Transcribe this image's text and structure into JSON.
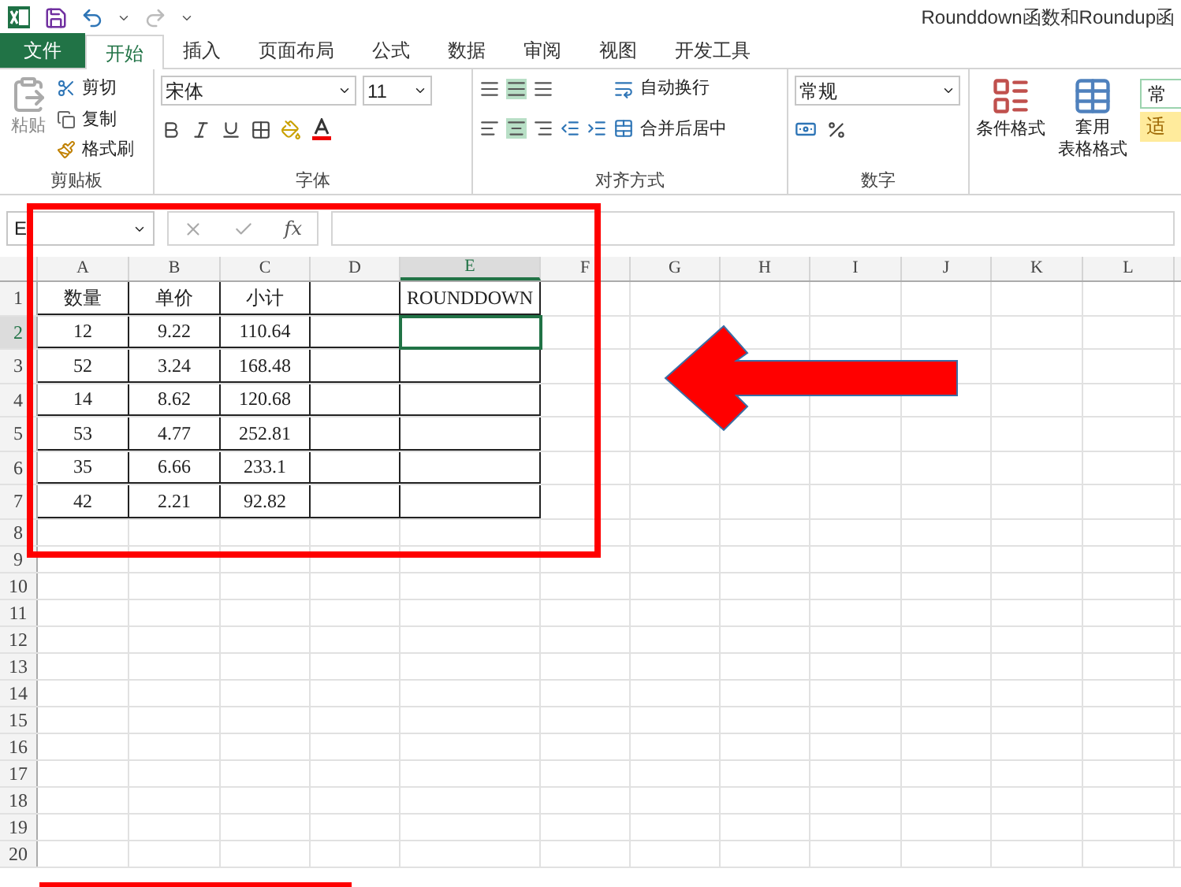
{
  "window": {
    "title": "Rounddown函数和Roundup函"
  },
  "tabs": [
    {
      "label": "文件",
      "kind": "file",
      "selected": false
    },
    {
      "label": "开始",
      "kind": "tab",
      "selected": true
    },
    {
      "label": "插入",
      "kind": "tab",
      "selected": false
    },
    {
      "label": "页面布局",
      "kind": "tab",
      "selected": false
    },
    {
      "label": "公式",
      "kind": "tab",
      "selected": false
    },
    {
      "label": "数据",
      "kind": "tab",
      "selected": false
    },
    {
      "label": "审阅",
      "kind": "tab",
      "selected": false
    },
    {
      "label": "视图",
      "kind": "tab",
      "selected": false
    },
    {
      "label": "开发工具",
      "kind": "tab",
      "selected": false
    }
  ],
  "ribbon": {
    "clipboard": {
      "title": "剪贴板",
      "paste": "粘贴",
      "cut": "剪切",
      "copy": "复制",
      "format_painter": "格式刷"
    },
    "font": {
      "title": "字体",
      "font_name": "宋体",
      "font_size": "11"
    },
    "alignment": {
      "title": "对齐方式",
      "wrap_text": "自动换行",
      "merge_center": "合并后居中"
    },
    "number": {
      "title": "数字",
      "format": "常规"
    },
    "styles": {
      "conditional_formatting": "条件格式",
      "format_as_table": [
        "套用",
        "表格格式"
      ],
      "cell_styles": [
        "常",
        "适"
      ]
    }
  },
  "formula_bar": {
    "name_box": "E",
    "function_label": "fx"
  },
  "columns": [
    {
      "label": "A",
      "selected": false
    },
    {
      "label": "B",
      "selected": false
    },
    {
      "label": "C",
      "selected": false
    },
    {
      "label": "D",
      "selected": false
    },
    {
      "label": "E",
      "selected": true
    },
    {
      "label": "F",
      "selected": false
    },
    {
      "label": "G",
      "selected": false
    },
    {
      "label": "H",
      "selected": false
    },
    {
      "label": "I",
      "selected": false
    },
    {
      "label": "J",
      "selected": false
    },
    {
      "label": "K",
      "selected": false
    },
    {
      "label": "L",
      "selected": false
    }
  ],
  "rows": [
    {
      "label": "1",
      "selected": false,
      "bordered": true,
      "cells": [
        "数量",
        "单价",
        "小计",
        null,
        "ROUNDDOWN"
      ]
    },
    {
      "label": "2",
      "selected": true,
      "bordered": true,
      "cells": [
        "12",
        "9.22",
        "110.64"
      ]
    },
    {
      "label": "3",
      "selected": false,
      "bordered": true,
      "cells": [
        "52",
        "3.24",
        "168.48"
      ]
    },
    {
      "label": "4",
      "selected": false,
      "bordered": true,
      "cells": [
        "14",
        "8.62",
        "120.68"
      ]
    },
    {
      "label": "5",
      "selected": false,
      "bordered": true,
      "cells": [
        "53",
        "4.77",
        "252.81"
      ]
    },
    {
      "label": "6",
      "selected": false,
      "bordered": true,
      "cells": [
        "35",
        "6.66",
        "233.1"
      ]
    },
    {
      "label": "7",
      "selected": false,
      "bordered": true,
      "cells": [
        "42",
        "2.21",
        "92.82"
      ]
    },
    {
      "label": "8",
      "selected": false,
      "bordered": false,
      "cells": []
    },
    {
      "label": "9",
      "selected": false,
      "bordered": false,
      "cells": []
    },
    {
      "label": "10",
      "selected": false,
      "bordered": false,
      "cells": []
    },
    {
      "label": "11",
      "selected": false,
      "bordered": false,
      "cells": []
    },
    {
      "label": "12",
      "selected": false,
      "bordered": false,
      "cells": []
    },
    {
      "label": "13",
      "selected": false,
      "bordered": false,
      "cells": []
    },
    {
      "label": "14",
      "selected": false,
      "bordered": false,
      "cells": []
    },
    {
      "label": "15",
      "selected": false,
      "bordered": false,
      "cells": []
    },
    {
      "label": "16",
      "selected": false,
      "bordered": false,
      "cells": []
    },
    {
      "label": "17",
      "selected": false,
      "bordered": false,
      "cells": []
    },
    {
      "label": "18",
      "selected": false,
      "bordered": false,
      "cells": []
    },
    {
      "label": "19",
      "selected": false,
      "bordered": false,
      "cells": []
    },
    {
      "label": "20",
      "selected": false,
      "bordered": false,
      "cells": []
    }
  ],
  "annotations": [
    {
      "kind": "rectangle"
    },
    {
      "kind": "arrow"
    },
    {
      "kind": "underline"
    }
  ]
}
